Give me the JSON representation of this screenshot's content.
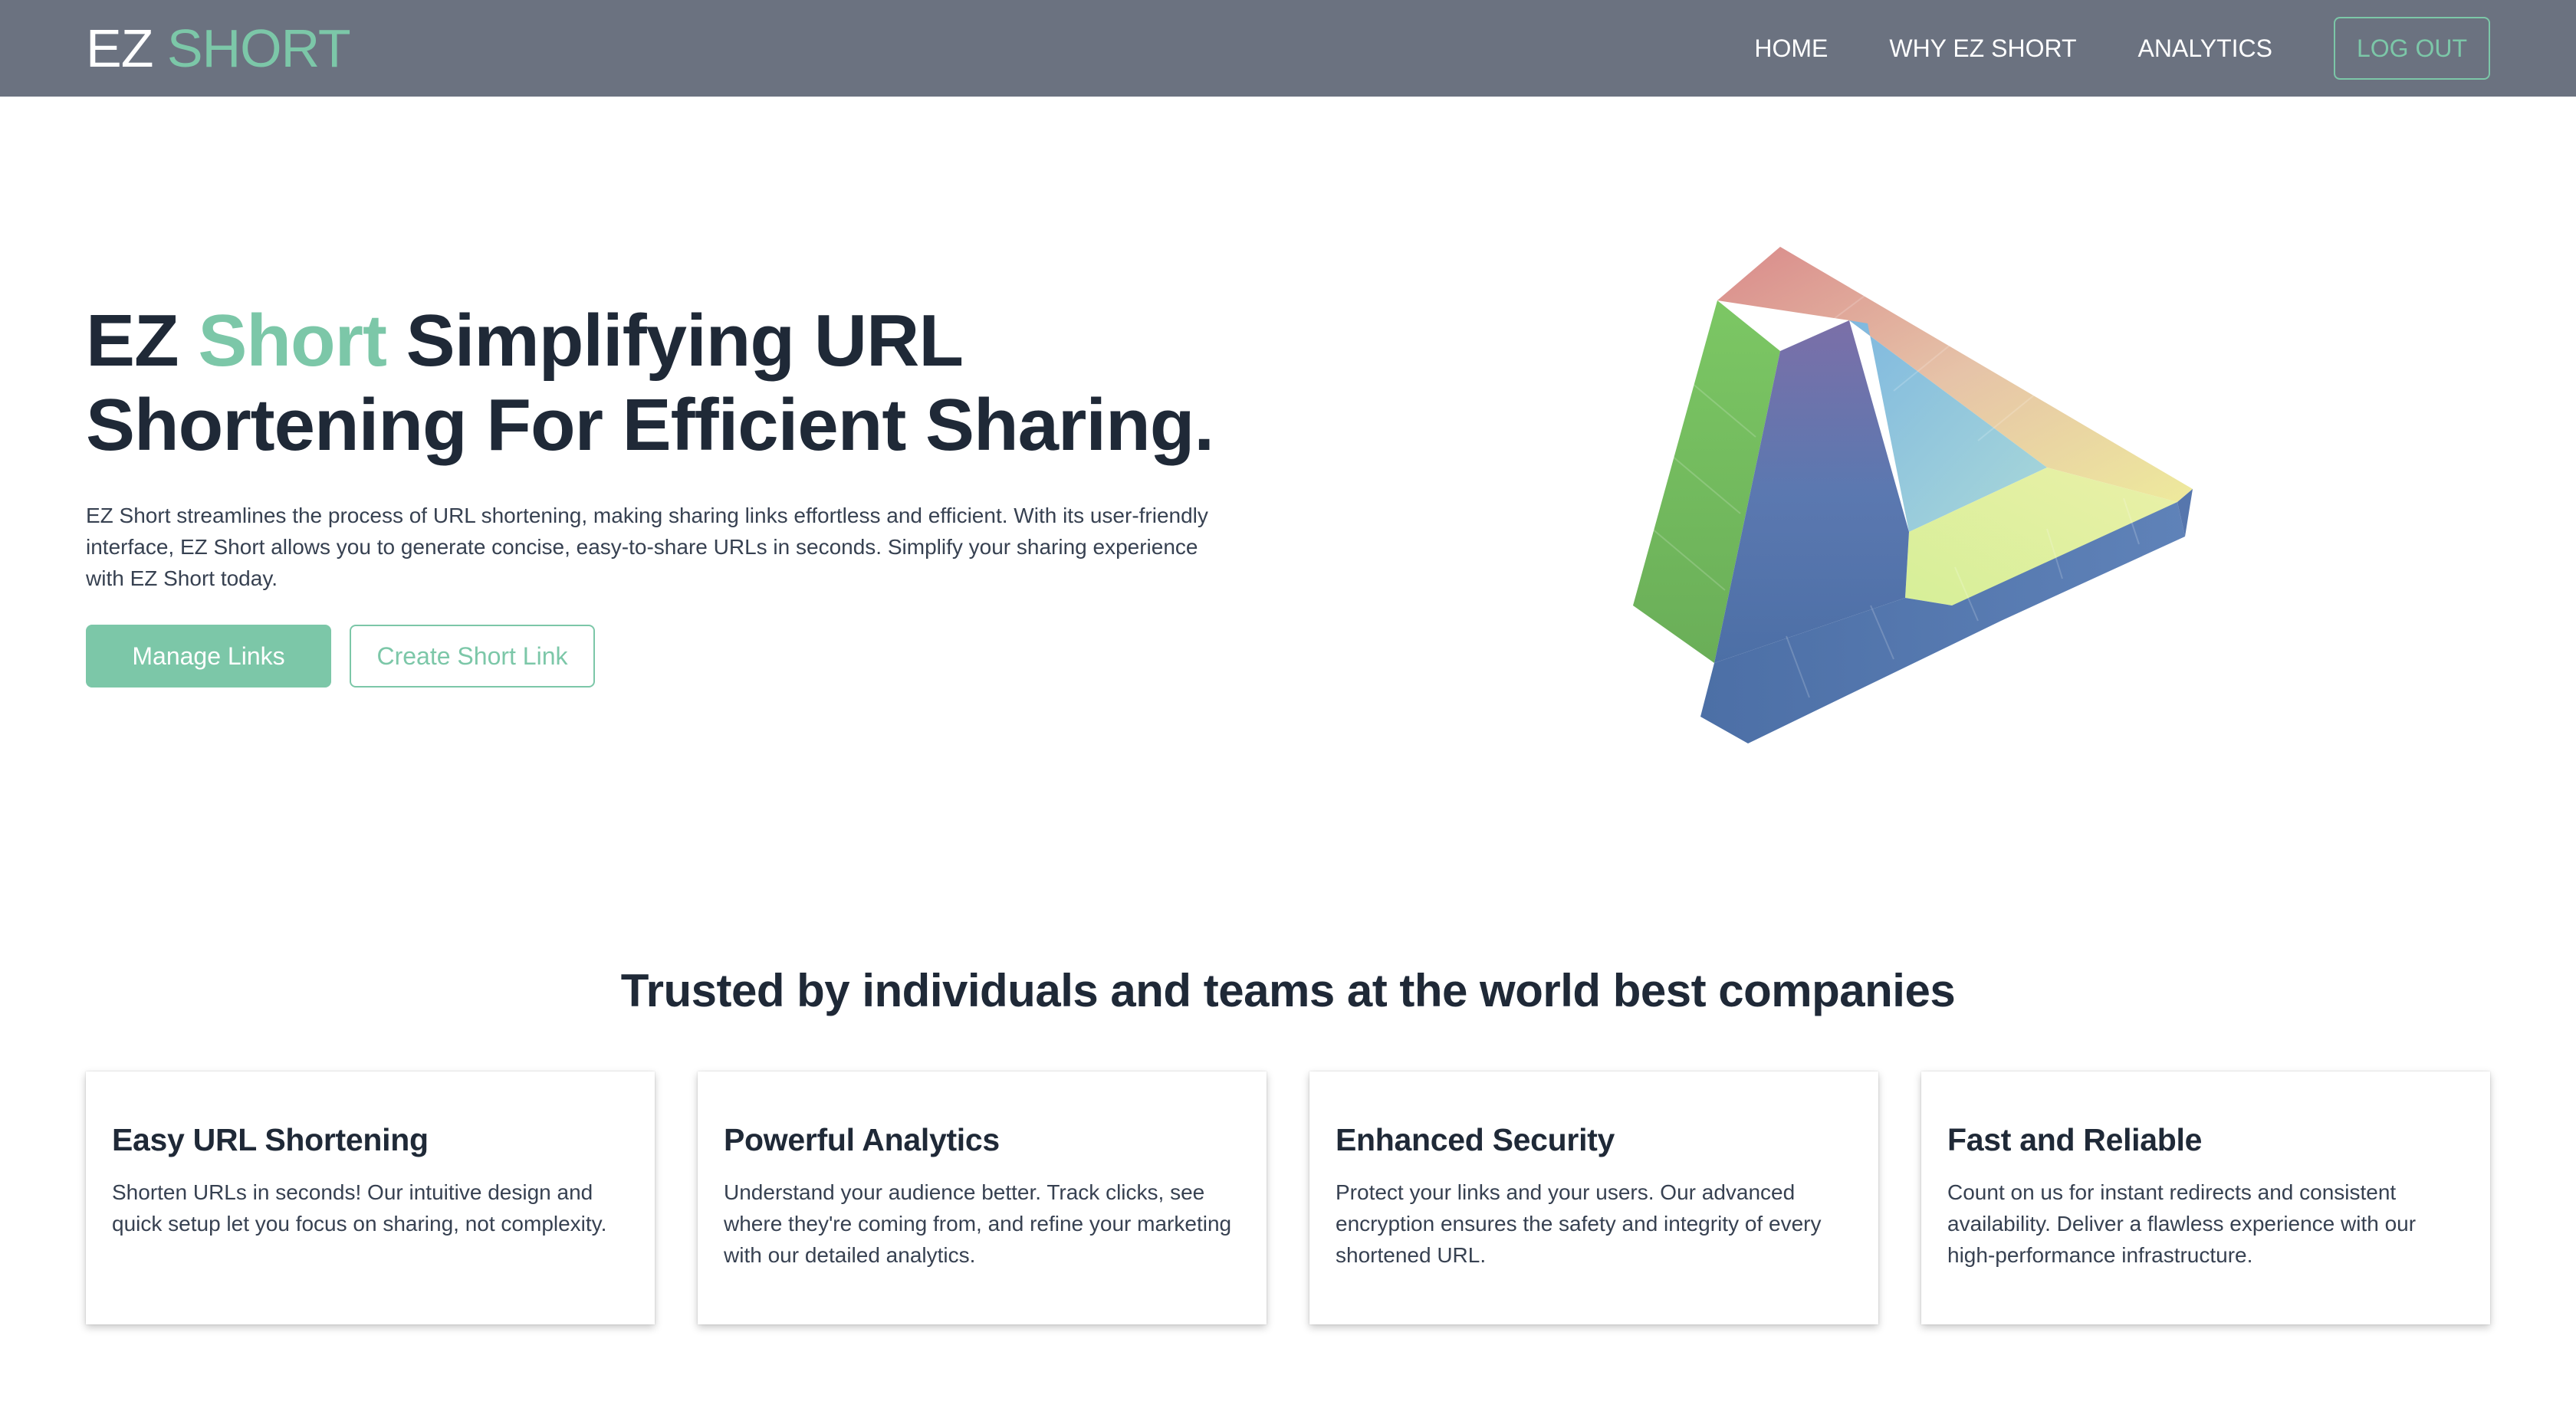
{
  "brand": {
    "prefix": "EZ",
    "accent": "SHORT"
  },
  "nav": {
    "home": "HOME",
    "why": "WHY EZ SHORT",
    "analytics": "ANALYTICS",
    "logout": "LOG OUT"
  },
  "hero": {
    "title_prefix": "EZ",
    "title_accent": "Short",
    "title_rest": "Simplifying URL Shortening For Efficient Sharing.",
    "description": "EZ Short streamlines the process of URL shortening, making sharing links effortless and efficient. With its user-friendly interface, EZ Short allows you to generate concise, easy-to-share URLs in seconds. Simplify your sharing experience with EZ Short today.",
    "primary_button": "Manage Links",
    "secondary_button": "Create Short Link"
  },
  "trusted": {
    "title": "Trusted by individuals and teams at the world best companies"
  },
  "features": [
    {
      "title": "Easy URL Shortening",
      "text": "Shorten URLs in seconds! Our intuitive design and quick setup let you focus on sharing, not complexity."
    },
    {
      "title": "Powerful Analytics",
      "text": "Understand your audience better. Track clicks, see where they're coming from, and refine your marketing with our detailed analytics."
    },
    {
      "title": "Enhanced Security",
      "text": "Protect your links and your users. Our advanced encryption ensures the safety and integrity of every shortened URL."
    },
    {
      "title": "Fast and Reliable",
      "text": "Count on us for instant redirects and consistent availability. Deliver a flawless experience with our high-performance infrastructure."
    }
  ],
  "colors": {
    "navbar": "#6b7280",
    "accent": "#7cc7a8",
    "heading": "#1f2937"
  },
  "illustration": "impossible-triangle-icon"
}
